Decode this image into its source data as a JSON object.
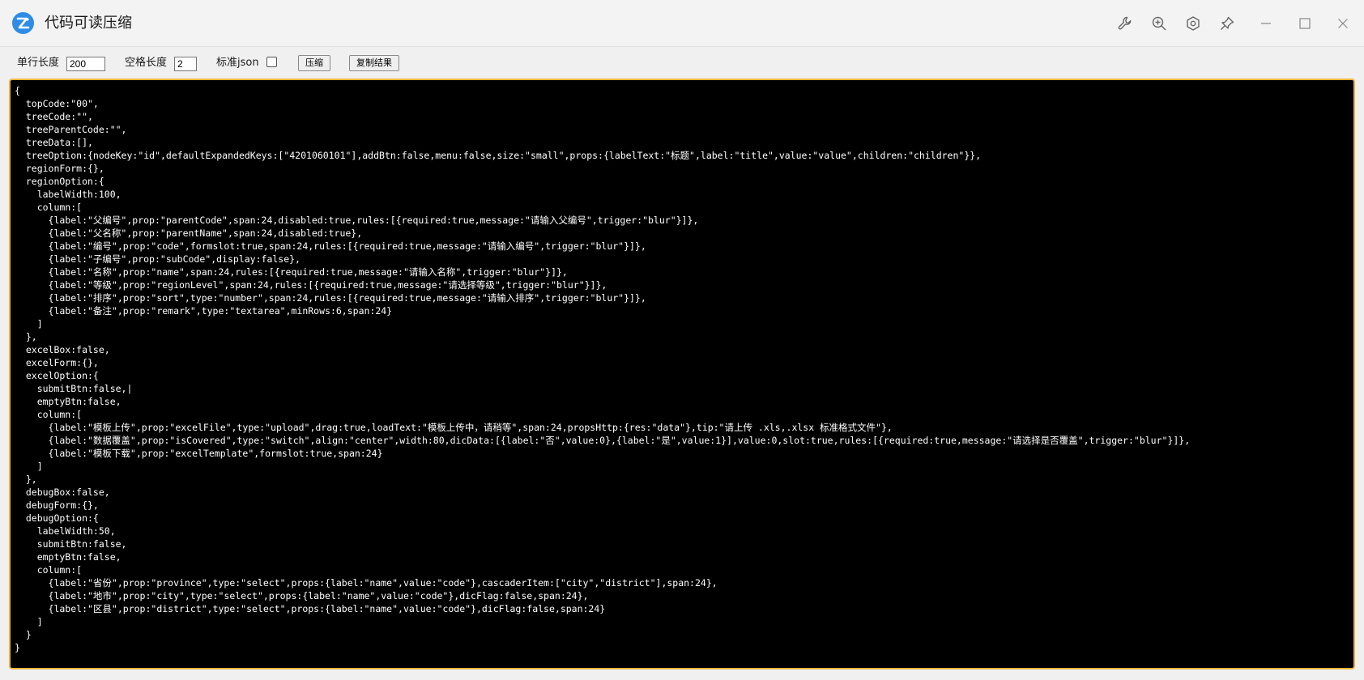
{
  "app": {
    "title": "代码可读压缩",
    "brand_color": "#2e8ce6"
  },
  "window_controls": [
    {
      "name": "wrench-icon"
    },
    {
      "name": "zoom-in-icon"
    },
    {
      "name": "settings-icon"
    },
    {
      "name": "pin-icon"
    },
    {
      "name": "minimize-icon"
    },
    {
      "name": "maximize-icon"
    },
    {
      "name": "close-icon"
    }
  ],
  "toolbar": {
    "line_length_label": "单行长度",
    "line_length_value": "200",
    "indent_label": "空格长度",
    "indent_value": "2",
    "json_label": "标准json",
    "json_checked": false,
    "compress_label": "压缩",
    "copy_label": "复制结果"
  },
  "editor": {
    "border_color": "#f0b43a",
    "text": "{\n  topCode:\"00\",\n  treeCode:\"\",\n  treeParentCode:\"\",\n  treeData:[],\n  treeOption:{nodeKey:\"id\",defaultExpandedKeys:[\"4201060101\"],addBtn:false,menu:false,size:\"small\",props:{labelText:\"标题\",label:\"title\",value:\"value\",children:\"children\"}},\n  regionForm:{},\n  regionOption:{\n    labelWidth:100,\n    column:[\n      {label:\"父编号\",prop:\"parentCode\",span:24,disabled:true,rules:[{required:true,message:\"请输入父编号\",trigger:\"blur\"}]},\n      {label:\"父名称\",prop:\"parentName\",span:24,disabled:true},\n      {label:\"编号\",prop:\"code\",formslot:true,span:24,rules:[{required:true,message:\"请输入编号\",trigger:\"blur\"}]},\n      {label:\"子编号\",prop:\"subCode\",display:false},\n      {label:\"名称\",prop:\"name\",span:24,rules:[{required:true,message:\"请输入名称\",trigger:\"blur\"}]},\n      {label:\"等级\",prop:\"regionLevel\",span:24,rules:[{required:true,message:\"请选择等级\",trigger:\"blur\"}]},\n      {label:\"排序\",prop:\"sort\",type:\"number\",span:24,rules:[{required:true,message:\"请输入排序\",trigger:\"blur\"}]},\n      {label:\"备注\",prop:\"remark\",type:\"textarea\",minRows:6,span:24}\n    ]\n  },\n  excelBox:false,\n  excelForm:{},\n  excelOption:{\n    submitBtn:false,|\n    emptyBtn:false,\n    column:[\n      {label:\"模板上传\",prop:\"excelFile\",type:\"upload\",drag:true,loadText:\"模板上传中，请稍等\",span:24,propsHttp:{res:\"data\"},tip:\"请上传 .xls,.xlsx 标准格式文件\"},\n      {label:\"数据覆盖\",prop:\"isCovered\",type:\"switch\",align:\"center\",width:80,dicData:[{label:\"否\",value:0},{label:\"是\",value:1}],value:0,slot:true,rules:[{required:true,message:\"请选择是否覆盖\",trigger:\"blur\"}]},\n      {label:\"模板下载\",prop:\"excelTemplate\",formslot:true,span:24}\n    ]\n  },\n  debugBox:false,\n  debugForm:{},\n  debugOption:{\n    labelWidth:50,\n    submitBtn:false,\n    emptyBtn:false,\n    column:[\n      {label:\"省份\",prop:\"province\",type:\"select\",props:{label:\"name\",value:\"code\"},cascaderItem:[\"city\",\"district\"],span:24},\n      {label:\"地市\",prop:\"city\",type:\"select\",props:{label:\"name\",value:\"code\"},dicFlag:false,span:24},\n      {label:\"区县\",prop:\"district\",type:\"select\",props:{label:\"name\",value:\"code\"},dicFlag:false,span:24}\n    ]\n  }\n}"
  }
}
